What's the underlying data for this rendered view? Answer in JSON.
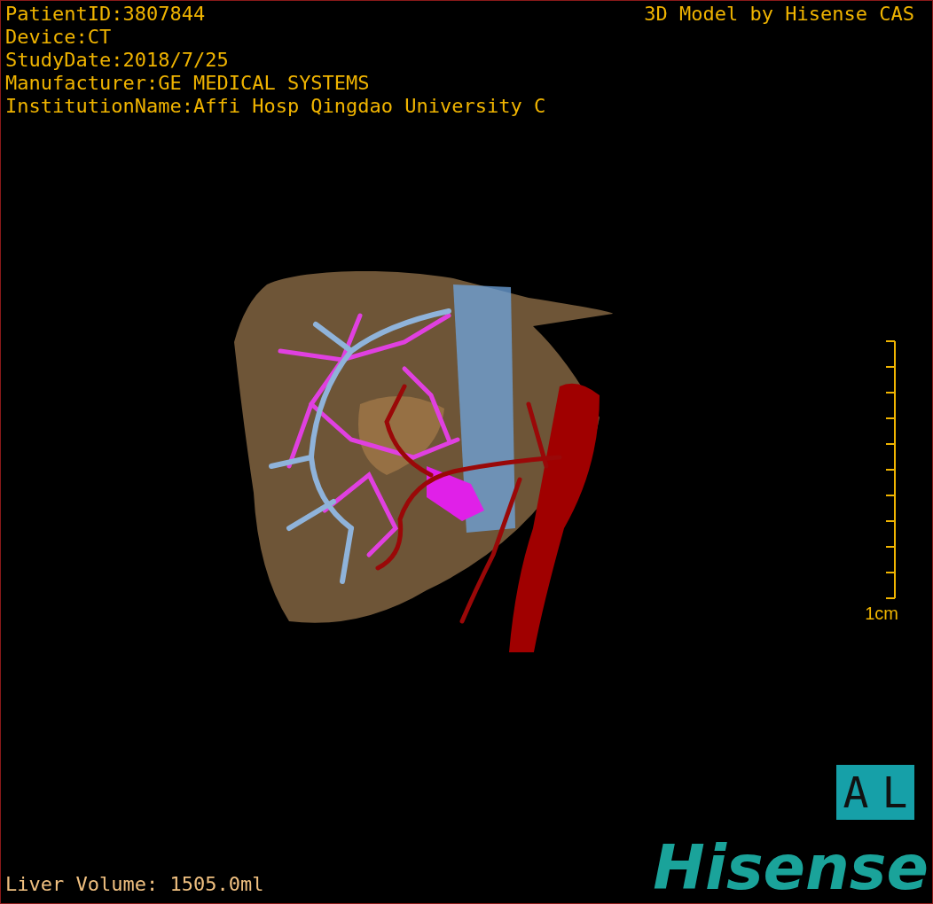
{
  "info_lines": [
    "PatientID:3807844",
    "Device:CT",
    "StudyDate:2018/7/25",
    "Manufacturer:GE MEDICAL SYSTEMS",
    "InstitutionName:Affi Hosp Qingdao University C"
  ],
  "credit": "3D Model by Hisense CAS",
  "scale_bar": {
    "label": "1cm"
  },
  "orientation": [
    "A",
    "L"
  ],
  "liver_volume": "Liver Volume: 1505.0ml",
  "logo": "Hisense"
}
